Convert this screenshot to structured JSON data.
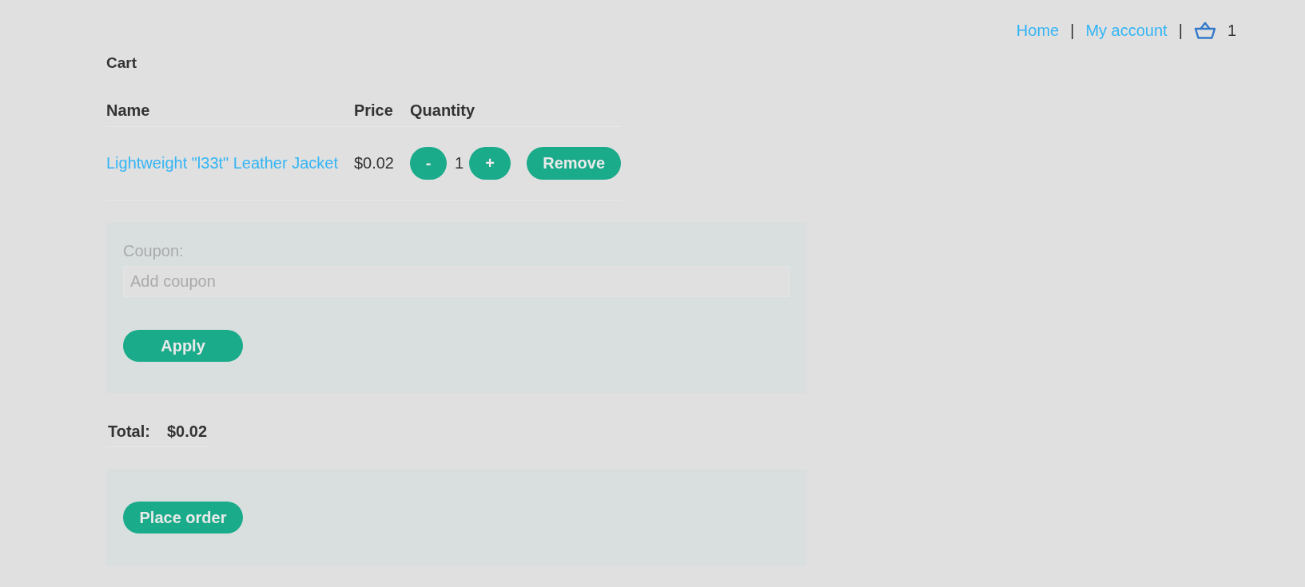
{
  "nav": [
    {
      "kind": "link",
      "label": "Home"
    },
    {
      "kind": "separator",
      "label": "|"
    },
    {
      "kind": "link",
      "label": "My account"
    },
    {
      "kind": "separator",
      "label": "|"
    },
    {
      "kind": "cart",
      "count": "1"
    }
  ],
  "cart": {
    "title": "Cart",
    "columns": [
      "Name",
      "Price",
      "Quantity"
    ],
    "rows": [
      {
        "name": "Lightweight \"l33t\" Leather Jacket",
        "price": "$0.02",
        "decrease": "-",
        "quantity": "1",
        "increase": "+",
        "remove": "Remove"
      }
    ]
  },
  "coupon": {
    "label": "Coupon:",
    "placeholder": "Add coupon",
    "button": "Apply"
  },
  "total": {
    "label": "Total:",
    "value": "$0.02"
  },
  "order": {
    "button": "Place order"
  }
}
